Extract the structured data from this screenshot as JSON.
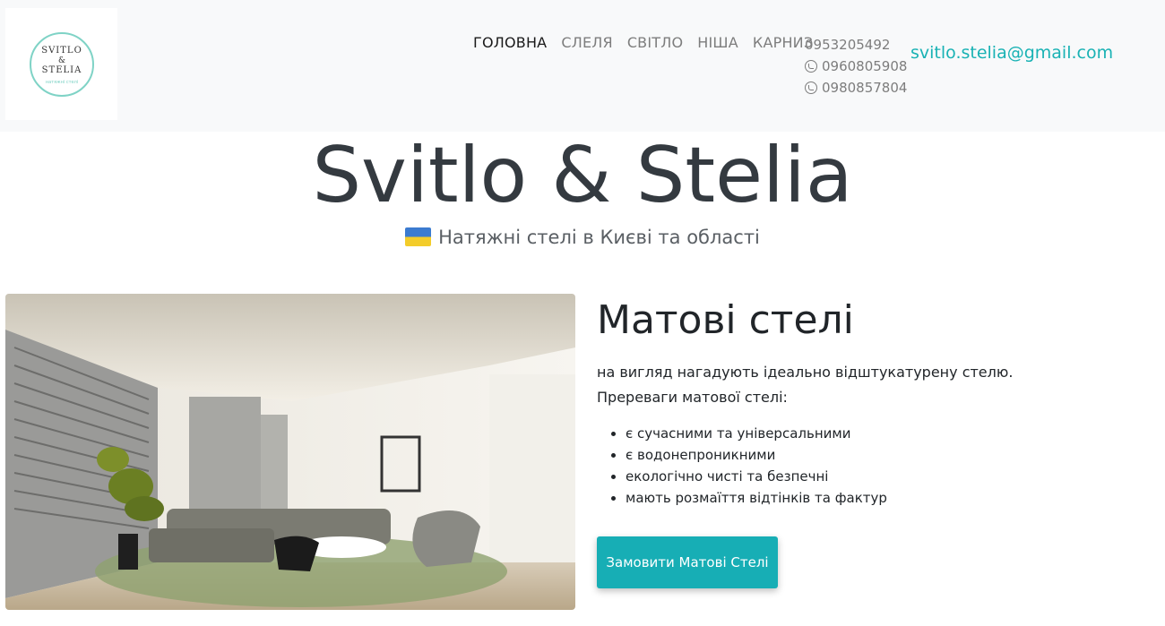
{
  "brand": {
    "logo_line1": "SVITLO",
    "logo_amp": "&",
    "logo_line2": "STELIA",
    "logo_tagline": "натяжні стелі"
  },
  "nav": {
    "items": [
      {
        "label": "ГОЛОВНА",
        "active": true
      },
      {
        "label": "СЛЕЛЯ",
        "active": false
      },
      {
        "label": "СВІТЛО",
        "active": false
      },
      {
        "label": "НІША",
        "active": false
      },
      {
        "label": "КАРНИЗ",
        "active": false
      }
    ],
    "phones": [
      {
        "number": "0953205492",
        "icon": null
      },
      {
        "number": "0960805908",
        "icon": "viber-icon"
      },
      {
        "number": "0980857804",
        "icon": "viber-icon"
      }
    ],
    "email": "svitlo.stelia@gmail.com"
  },
  "hero": {
    "title": "Svitlo & Stelia",
    "subtitle": "Натяжні стелі в Києві та області"
  },
  "section": {
    "title": "Матові стелі",
    "desc_line1": "на вигляд нагадують ідеально відштукатурену стелю.",
    "desc_line2": "Пререваги матової стелі:",
    "benefits": [
      "є сучасними та універсальними",
      "є водонепроникними",
      "екологічно чисті та безпечні",
      "мають розмаїття відтінків та фактур"
    ],
    "button_label": "Замовити Матові Стелі"
  },
  "colors": {
    "accent": "#17aeb5",
    "navbar_bg": "#f8f9fa",
    "logo_ring": "#7fd3c6",
    "title_dark": "#343a40"
  }
}
